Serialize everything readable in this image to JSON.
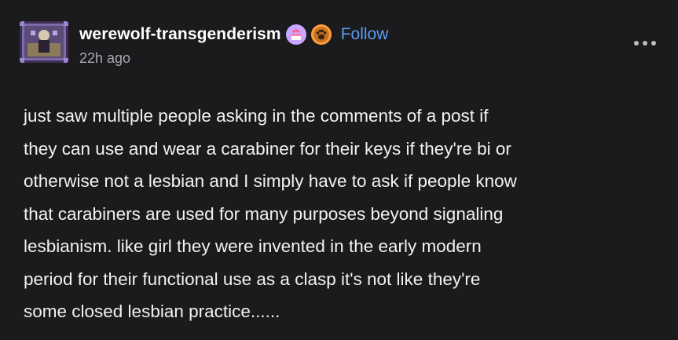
{
  "post": {
    "author": {
      "username": "werewolf-transgenderism",
      "avatar_icon": "avatar-image",
      "badges": [
        {
          "icon": "cake-badge-icon",
          "color": "#c9a7ff"
        },
        {
          "icon": "paw-badge-icon",
          "color": "#ff9d3b"
        }
      ]
    },
    "follow_label": "Follow",
    "timestamp": "22h ago",
    "more_icon": "more-options-icon",
    "body": "just saw multiple people asking in the comments of a post if\nthey can use and wear a carabiner for their keys if they're bi or\notherwise not a lesbian and I simply have to ask if people know\nthat carabiners are used for many purposes beyond signaling\nlesbianism. like girl they were invented in the early modern\nperiod for their functional use as a clasp it's not like they're\nsome closed lesbian practice......"
  },
  "colors": {
    "background": "#1b1a1c",
    "text": "#f2f2f2",
    "follow": "#5b9df5",
    "muted": "#a9a9ad"
  }
}
